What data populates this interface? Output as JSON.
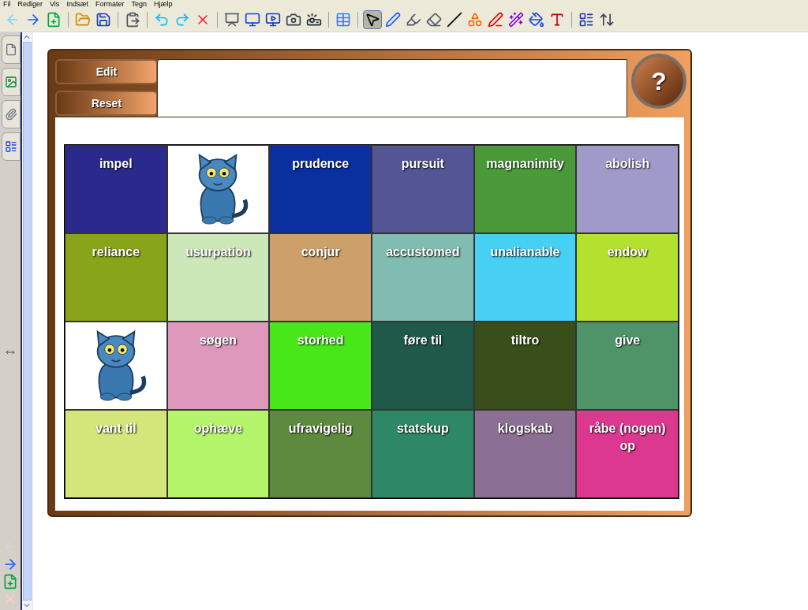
{
  "menu": [
    "Fil",
    "Rediger",
    "Vis",
    "Indsæt",
    "Formater",
    "Tegn",
    "Hjælp"
  ],
  "drawing_tools": [
    {
      "selected": true
    },
    {
      "selected": false
    },
    {
      "selected": false
    },
    {
      "selected": false
    },
    {
      "selected": false
    },
    {
      "selected": false
    },
    {
      "selected": false
    },
    {
      "selected": false
    },
    {
      "selected": false
    },
    {
      "selected": false
    }
  ],
  "page_nav": {
    "back_disabled": true,
    "delete_disabled": true
  },
  "board": {
    "buttons": [
      "Edit",
      "Reset"
    ],
    "help": "?",
    "cells": [
      {
        "kind": "word",
        "text": "impel",
        "color": "#2a2a8c"
      },
      {
        "kind": "cat"
      },
      {
        "kind": "word",
        "text": "prudence",
        "color": "#0a30a0"
      },
      {
        "kind": "word",
        "text": "pursuit",
        "color": "#545594"
      },
      {
        "kind": "word",
        "text": "magnanimity",
        "color": "#4a9a3a"
      },
      {
        "kind": "word",
        "text": "abolish",
        "color": "#a09ac8"
      },
      {
        "kind": "word",
        "text": "reliance",
        "color": "#88a418"
      },
      {
        "kind": "word",
        "text": "usurpation",
        "color": "#cce8b8"
      },
      {
        "kind": "word",
        "text": "conjur",
        "color": "#cca068"
      },
      {
        "kind": "word",
        "text": "accustomed",
        "color": "#80bcb0"
      },
      {
        "kind": "word",
        "text": "unalianable",
        "color": "#48d0f4"
      },
      {
        "kind": "word",
        "text": "endow",
        "color": "#b4e030"
      },
      {
        "kind": "cat"
      },
      {
        "kind": "word",
        "text": "søgen",
        "color": "#de98bc"
      },
      {
        "kind": "word",
        "text": "storhed",
        "color": "#48e818"
      },
      {
        "kind": "word",
        "text": "føre til",
        "color": "#20584a"
      },
      {
        "kind": "word",
        "text": "tiltro",
        "color": "#3a4e1a"
      },
      {
        "kind": "word",
        "text": "give",
        "color": "#4e9468"
      },
      {
        "kind": "word",
        "text": "vant til",
        "color": "#d4e67a"
      },
      {
        "kind": "word",
        "text": "ophæve",
        "color": "#b4f46a"
      },
      {
        "kind": "word",
        "text": "ufravigelig",
        "color": "#5e8a40"
      },
      {
        "kind": "word",
        "text": "statskup",
        "color": "#2e8866"
      },
      {
        "kind": "word",
        "text": "klogskab",
        "color": "#8c7094"
      },
      {
        "kind": "word",
        "text": "råbe (nogen) op",
        "color": "#dc3890"
      }
    ]
  }
}
